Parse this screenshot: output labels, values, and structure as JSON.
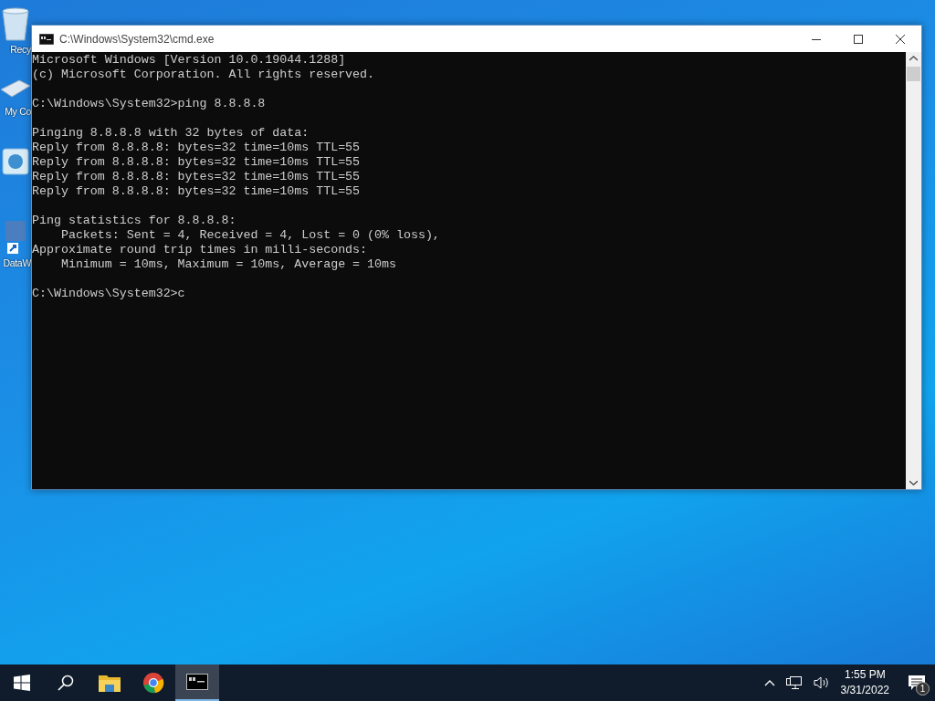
{
  "desktop_icons": [
    {
      "kind": "recycle",
      "label": "Recy"
    },
    {
      "kind": "computer",
      "label": "My Co"
    },
    {
      "kind": "app"
    },
    {
      "kind": "shortcut",
      "label": "DataW"
    }
  ],
  "window": {
    "title": "C:\\Windows\\System32\\cmd.exe"
  },
  "console": {
    "blocks": [
      [
        "Microsoft Windows [Version 10.0.19044.1288]",
        "(c) Microsoft Corporation. All rights reserved."
      ],
      [
        "C:\\Windows\\System32>ping 8.8.8.8"
      ],
      [
        "Pinging 8.8.8.8 with 32 bytes of data:",
        "Reply from 8.8.8.8: bytes=32 time=10ms TTL=55",
        "Reply from 8.8.8.8: bytes=32 time=10ms TTL=55",
        "Reply from 8.8.8.8: bytes=32 time=10ms TTL=55",
        "Reply from 8.8.8.8: bytes=32 time=10ms TTL=55"
      ],
      [
        "Ping statistics for 8.8.8.8:",
        "    Packets: Sent = 4, Received = 4, Lost = 0 (0% loss),",
        "Approximate round trip times in milli-seconds:",
        "    Minimum = 10ms, Maximum = 10ms, Average = 10ms"
      ],
      [
        "C:\\Windows\\System32>c"
      ]
    ]
  },
  "taskbar": {
    "apps": [
      {
        "kind": "explorer",
        "selected": false
      },
      {
        "kind": "browser",
        "selected": false
      },
      {
        "kind": "terminal",
        "selected": true
      }
    ],
    "clock": {
      "time": "1:55 PM",
      "date": "3/31/2022"
    },
    "notification_count": "1"
  }
}
